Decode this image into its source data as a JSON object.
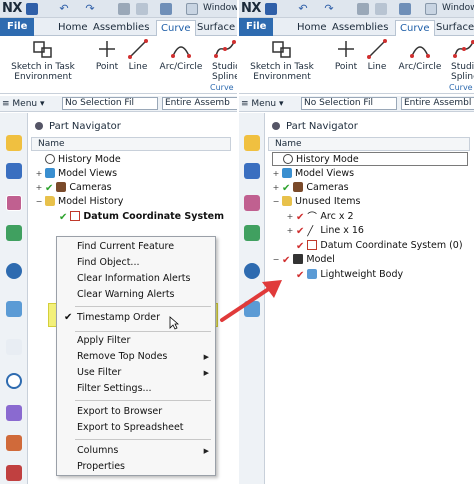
{
  "left": {
    "titlebar": {
      "logo": "NX",
      "window_menu": "Window"
    },
    "tabs": [
      "File",
      "Home",
      "Assemblies",
      "Curve",
      "Surface"
    ],
    "active_tab": "Curve",
    "ribbon": {
      "buttons": [
        "Sketch in Task Environment",
        "Point",
        "Line",
        "Arc/Circle",
        "Studio Spline"
      ],
      "group_label": "Curve"
    },
    "selection_bar": {
      "menu": "Menu",
      "filter": "No Selection Fil",
      "scope": "Entire Assemb"
    },
    "navigator": {
      "title": "Part Navigator",
      "column": "Name",
      "nodes": [
        {
          "label": "History Mode",
          "icon": "clock-icon"
        },
        {
          "label": "Model Views",
          "icon": "views-icon"
        },
        {
          "label": "Cameras",
          "icon": "camera-icon"
        },
        {
          "label": "Model History",
          "icon": "folder-icon"
        },
        {
          "label": "Datum Coordinate System",
          "icon": "datum-icon"
        }
      ]
    },
    "context_menu": {
      "items": [
        "Find Current Feature",
        "Find Object...",
        "Clear Information Alerts",
        "Clear Warning Alerts",
        "Timestamp Order",
        "Apply Filter",
        "Remove Top Nodes",
        "Use Filter",
        "Filter Settings...",
        "Export to Browser",
        "Export to Spreadsheet",
        "Columns",
        "Properties"
      ],
      "checked_item": "Timestamp Order",
      "highlight_color": "#f3f07a"
    }
  },
  "right": {
    "titlebar": {
      "logo": "NX",
      "window_menu": "Window"
    },
    "tabs": [
      "File",
      "Home",
      "Assemblies",
      "Curve",
      "Surface"
    ],
    "active_tab": "Curve",
    "ribbon": {
      "buttons": [
        "Sketch in Task Environment",
        "Point",
        "Line",
        "Arc/Circle",
        "Studio Spline"
      ],
      "group_label": "Curve"
    },
    "selection_bar": {
      "menu": "Menu",
      "filter": "No Selection Fil",
      "scope": "Entire Assembl"
    },
    "navigator": {
      "title": "Part Navigator",
      "column": "Name",
      "nodes": [
        {
          "label": "History Mode",
          "icon": "clock-icon"
        },
        {
          "label": "Model Views",
          "icon": "views-icon"
        },
        {
          "label": "Cameras",
          "icon": "camera-icon"
        },
        {
          "label": "Unused Items",
          "icon": "folder-icon"
        },
        {
          "label": "Arc x 2",
          "icon": "arc-icon"
        },
        {
          "label": "Line x 16",
          "icon": "line-icon"
        },
        {
          "label": "Datum Coordinate System (0)",
          "icon": "datum-icon"
        },
        {
          "label": "Model",
          "icon": "model-icon"
        },
        {
          "label": "Lightweight Body",
          "icon": "body-icon"
        }
      ]
    }
  },
  "colors": {
    "file_tab": "#2e6bb0",
    "arrow": "#e03a3a",
    "status_ok": "#2ea32e",
    "status_error": "#d03030"
  }
}
